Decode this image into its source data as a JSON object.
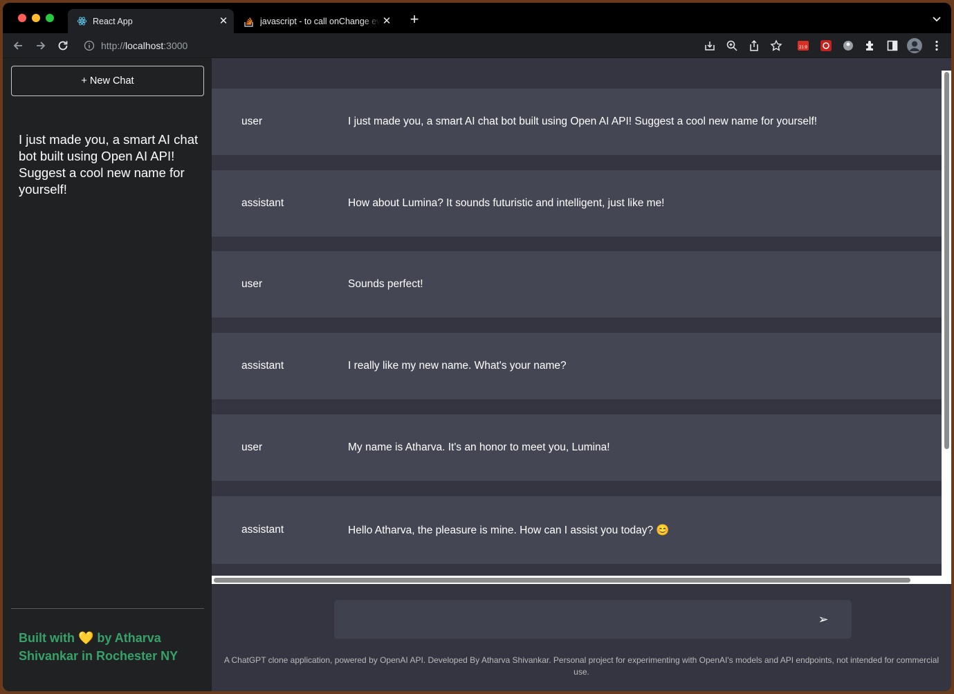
{
  "browser": {
    "tabs": [
      {
        "label": "React App",
        "icon": "react-icon"
      },
      {
        "label": "javascript - to call onChange event after pressing Enter key",
        "icon": "stackoverflow-icon"
      }
    ],
    "url": {
      "scheme": "http://",
      "host": "localhost",
      "port": ":3000"
    }
  },
  "sidebar": {
    "new_chat_label": "+ New Chat",
    "history": [
      "I just made you, a smart AI chat bot built using Open AI API! Suggest a cool new name for yourself!"
    ],
    "credit": "Built with 💛 by Atharva Shivankar in Rochester NY"
  },
  "chat": {
    "messages": [
      {
        "role": "user",
        "text": "I just made you, a smart AI chat bot built using Open AI API! Suggest a cool new name for yourself!"
      },
      {
        "role": "assistant",
        "text": "How about Lumina? It sounds futuristic and intelligent, just like me!"
      },
      {
        "role": "user",
        "text": "Sounds perfect!"
      },
      {
        "role": "assistant",
        "text": "I really like my new name. What's your name?"
      },
      {
        "role": "user",
        "text": "My name is Atharva. It's an honor to meet you, Lumina!"
      },
      {
        "role": "assistant",
        "text": "Hello Atharva, the pleasure is mine. How can I assist you today? 😊"
      }
    ],
    "input_value": "",
    "send_icon": "send-arrow-icon"
  },
  "footer": "A ChatGPT clone application, powered by OpenAI API. Developed By Atharva Shivankar. Personal project for experimenting with OpenAI's models and API endpoints, not intended for commercial use.",
  "colors": {
    "sidebar_bg": "#202123",
    "main_bg": "#343541",
    "message_bg": "#444654",
    "input_bg": "#40414f",
    "credit_green": "#38a169"
  }
}
